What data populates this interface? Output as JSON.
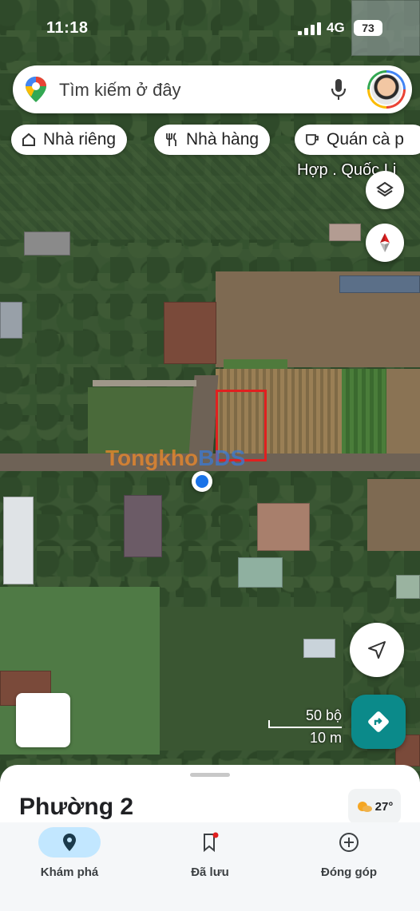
{
  "status_bar": {
    "time": "11:18",
    "network": "4G",
    "battery": "73"
  },
  "search": {
    "placeholder": "Tìm kiếm ở đây",
    "icons": [
      "maps-pin-icon",
      "mic-icon",
      "avatar"
    ]
  },
  "chips": [
    {
      "label": "Nhà riêng",
      "icon": "home-icon"
    },
    {
      "label": "Nhà hàng",
      "icon": "restaurant-icon"
    },
    {
      "label": "Quán cà p",
      "icon": "coffee-icon"
    }
  ],
  "map": {
    "label": "Hợp . Quốc Lị",
    "watermark": {
      "part1": "Tong",
      "part2": "kho",
      "part3": "BDS"
    },
    "scale": {
      "imperial": "50 bộ",
      "metric": "10 m"
    },
    "controls": [
      "layers-icon",
      "compass-icon",
      "my-location-icon",
      "directions-icon"
    ]
  },
  "sheet": {
    "title": "Phường 2",
    "weather": "27°"
  },
  "nav": [
    {
      "label": "Khám phá",
      "icon": "explore-pin-icon",
      "active": true
    },
    {
      "label": "Đã lưu",
      "icon": "bookmark-icon",
      "active": false
    },
    {
      "label": "Đóng góp",
      "icon": "contribute-icon",
      "active": false
    }
  ],
  "colors": {
    "accent": "#1a73e8",
    "active_pill": "#c2e7ff",
    "directions": "#0b8a8a",
    "plot_outline": "#e02020"
  }
}
